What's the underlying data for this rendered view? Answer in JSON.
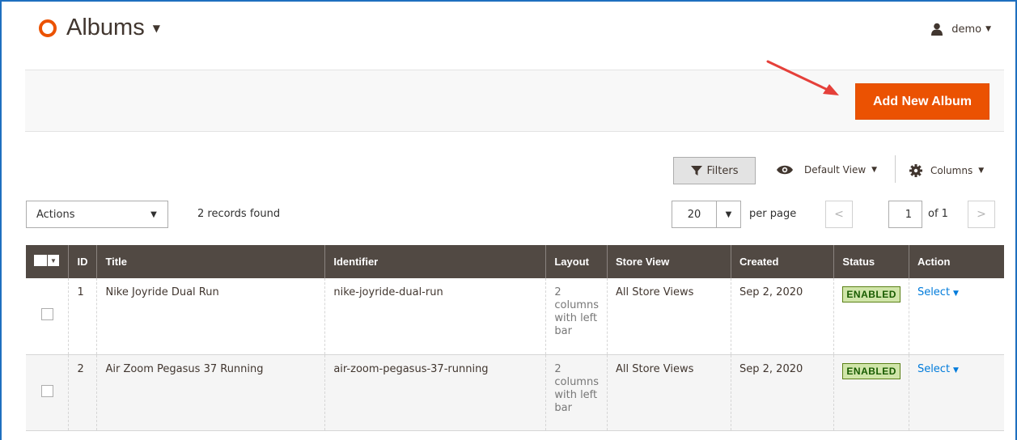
{
  "header": {
    "title": "Albums",
    "user": "demo"
  },
  "action_bar": {
    "add_button": "Add New Album"
  },
  "toolbar": {
    "filters_label": "Filters",
    "view_label": "Default View",
    "columns_label": "Columns",
    "actions_label": "Actions",
    "records_found": "2 records found",
    "per_page_value": "20",
    "per_page_label": "per page",
    "current_page": "1",
    "total_pages_label": "of 1"
  },
  "grid": {
    "columns": [
      "ID",
      "Title",
      "Identifier",
      "Layout",
      "Store View",
      "Created",
      "Status",
      "Action"
    ],
    "rows": [
      {
        "id": "1",
        "title": "Nike Joyride Dual Run",
        "identifier": "nike-joyride-dual-run",
        "layout": "2 columns with left bar",
        "store_view": "All Store Views",
        "created": "Sep 2, 2020",
        "status": "ENABLED",
        "action": "Select"
      },
      {
        "id": "2",
        "title": "Air Zoom Pegasus 37 Running",
        "identifier": "air-zoom-pegasus-37-running",
        "layout": "2 columns with left bar",
        "store_view": "All Store Views",
        "created": "Sep 2, 2020",
        "status": "ENABLED",
        "action": "Select"
      }
    ]
  },
  "colors": {
    "accent": "#eb5202",
    "header_bg": "#514943",
    "link": "#007bdb",
    "status_bg": "#d0e5a9",
    "annotation_arrow": "#e5403a"
  },
  "icons": {
    "logo": "ring-logo-icon",
    "user": "user-icon",
    "filter": "funnel-icon",
    "view": "eye-icon",
    "columns": "gear-icon"
  }
}
